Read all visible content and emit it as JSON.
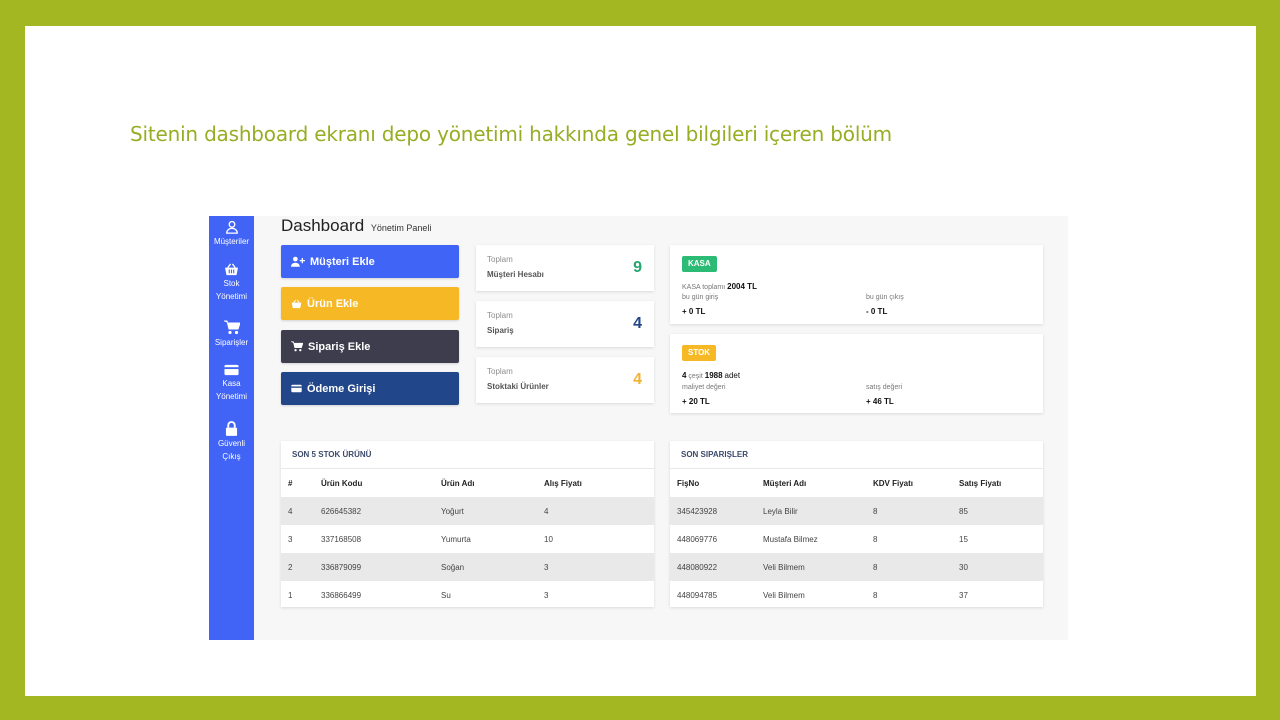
{
  "slide_title": "Sitenin dashboard ekranı depo yönetimi hakkında genel bilgileri içeren bölüm",
  "sidebar": {
    "items": [
      {
        "icon": "user-icon",
        "lines": [
          "Müşteriler"
        ]
      },
      {
        "icon": "basket-icon",
        "lines": [
          "Stok",
          "Yönetimi"
        ]
      },
      {
        "icon": "cart-icon",
        "lines": [
          "Siparişler"
        ]
      },
      {
        "icon": "card-icon",
        "lines": [
          "Kasa",
          "Yönetimi"
        ]
      },
      {
        "icon": "lock-icon",
        "lines": [
          "Güvenli",
          "Çıkış"
        ]
      }
    ]
  },
  "header": {
    "title": "Dashboard",
    "subtitle": "Yönetim Paneli"
  },
  "quick_actions": [
    {
      "label": "Müşteri Ekle",
      "icon": "user-plus-icon",
      "color": "#3f64f6"
    },
    {
      "label": "Ürün Ekle",
      "icon": "basket-icon",
      "color": "#f7b825"
    },
    {
      "label": "Sipariş Ekle",
      "icon": "cart-icon",
      "color": "#3d3d4d"
    },
    {
      "label": "Ödeme Girişi",
      "icon": "card-icon",
      "color": "#22468a"
    }
  ],
  "stats": [
    {
      "label1": "Toplam",
      "label2": "Müşteri Hesabı",
      "value": "9",
      "color": "#27a571"
    },
    {
      "label1": "Toplam",
      "label2": "Sipariş",
      "value": "4",
      "color": "#22468a"
    },
    {
      "label1": "Toplam",
      "label2": "Stoktaki Ürünler",
      "value": "4",
      "color": "#f4b233"
    }
  ],
  "kasa": {
    "badge": "KASA",
    "badge_color": "#2bbb75",
    "total_prefix": "KASA toplamı",
    "total_value": "2004 TL",
    "left_label": "bu gün giriş",
    "left_value": "+ 0 TL",
    "right_label": "bu gün çıkış",
    "right_value": "- 0 TL"
  },
  "stok": {
    "badge": "STOK",
    "badge_color": "#f7b825",
    "count": "4",
    "count_label": "çeşit",
    "total": "1988",
    "total_label": "adet",
    "left_label": "maliyet değeri",
    "left_value": "+ 20 TL",
    "right_label": "satış değeri",
    "right_value": "+ 46 TL"
  },
  "stock_table": {
    "title": "SON 5 STOK ÜRÜNÜ",
    "columns": [
      "#",
      "Ürün Kodu",
      "Ürün Adı",
      "Alış Fiyatı"
    ],
    "rows": [
      [
        "4",
        "626645382",
        "Yoğurt",
        "4"
      ],
      [
        "3",
        "337168508",
        "Yumurta",
        "10"
      ],
      [
        "2",
        "336879099",
        "Soğan",
        "3"
      ],
      [
        "1",
        "336866499",
        "Su",
        "3"
      ]
    ]
  },
  "orders_table": {
    "title": "SON SIPARIŞLER",
    "columns": [
      "FişNo",
      "Müşteri Adı",
      "KDV Fiyatı",
      "Satış Fiyatı"
    ],
    "rows": [
      [
        "345423928",
        "Leyla Bilir",
        "8",
        "85"
      ],
      [
        "448069776",
        "Mustafa Bilmez",
        "8",
        "15"
      ],
      [
        "448080922",
        "Veli Bilmem",
        "8",
        "30"
      ],
      [
        "448094785",
        "Veli Bilmem",
        "8",
        "37"
      ]
    ]
  }
}
